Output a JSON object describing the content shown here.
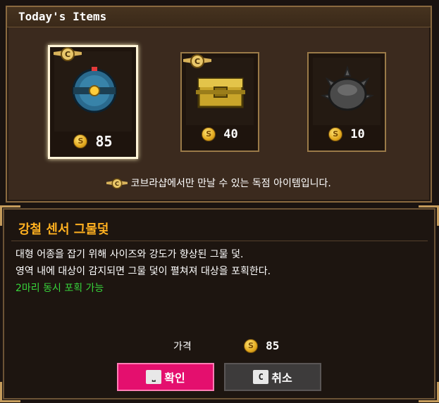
{
  "shop": {
    "title": "Today's Items",
    "notice": "코브라샵에서만 만날 수 있는 독점 아이템입니다.",
    "items": [
      {
        "name": "sensor-net-item",
        "price": "85",
        "selected": true,
        "badge": "C"
      },
      {
        "name": "treasure-chest-item",
        "price": "40",
        "selected": false,
        "badge": "C"
      },
      {
        "name": "spiked-mine-item",
        "price": "10",
        "selected": false,
        "badge": ""
      }
    ]
  },
  "detail": {
    "name": "강철 센서 그물덫",
    "desc_line1": "대형 어종을 잡기 위해 사이즈와 강도가 향상된 그물 덫.",
    "desc_line2": "영역 내에 대상이 감지되면 그물 덫이 펼쳐져 대상을 포획한다.",
    "highlight": "2마리 동시 포획 가능",
    "price_label": "가격",
    "price": "85"
  },
  "buttons": {
    "confirm_key": "⎵",
    "confirm_label": "확인",
    "cancel_key": "C",
    "cancel_label": "취소"
  },
  "colors": {
    "confirm": "#e40f6e",
    "highlight": "#37d43a",
    "item_name": "#ffb020"
  }
}
